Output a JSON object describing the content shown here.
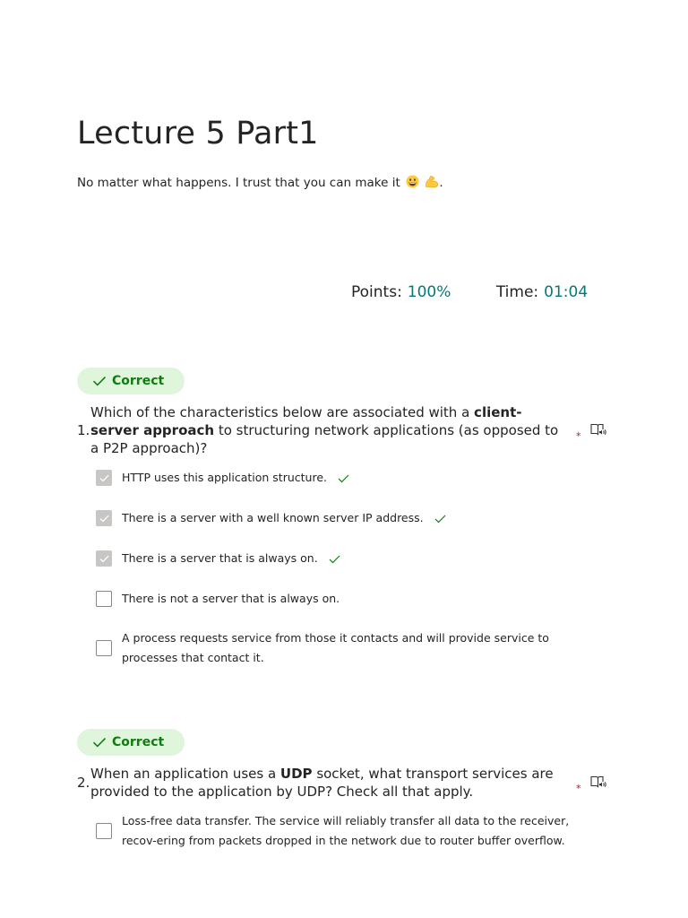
{
  "form": {
    "title": "Lecture 5 Part1",
    "description": "No matter what happens. I trust that you can make it",
    "description_end": ".",
    "emoji_1": "grinning-face",
    "emoji_2": "flexed-biceps"
  },
  "stats": {
    "points_label": "Points:",
    "points_value": "100%",
    "time_label": "Time:",
    "time_value": "01:04"
  },
  "colors": {
    "accent": "#03787c",
    "correct_text": "#107c10",
    "correct_bg": "#dff6dd",
    "required": "#c50f1f"
  },
  "questions": [
    {
      "number": "1.",
      "status": "Correct",
      "text_part1": "Which of the characteristics below are associated with a ",
      "text_bold": "client-server approach",
      "text_part2": " to structuring network applications (as opposed to a P2P approach)?",
      "required_mark": "*",
      "options": [
        {
          "label": "HTTP uses this application structure.",
          "checked": true,
          "correct": true
        },
        {
          "label": "There is a server with a well known server IP address.",
          "checked": true,
          "correct": true
        },
        {
          "label": "There is a server that is always on.",
          "checked": true,
          "correct": true
        },
        {
          "label": "There is not a server that is always on.",
          "checked": false,
          "correct": false
        },
        {
          "label": "A process requests service from those it contacts and will provide service to processes that contact it.",
          "checked": false,
          "correct": false
        }
      ]
    },
    {
      "number": "2.",
      "status": "Correct",
      "text_part1": "When an application uses a ",
      "text_bold": "UDP",
      "text_part2": " socket, what transport services are provided to the application by UDP? Check all that apply.",
      "required_mark": "*",
      "options": [
        {
          "label": "Loss-free data transfer. The service will reliably transfer all data to the receiver, recov-ering from packets dropped in the network due to router buffer overflow.",
          "checked": false,
          "correct": false
        }
      ]
    }
  ]
}
